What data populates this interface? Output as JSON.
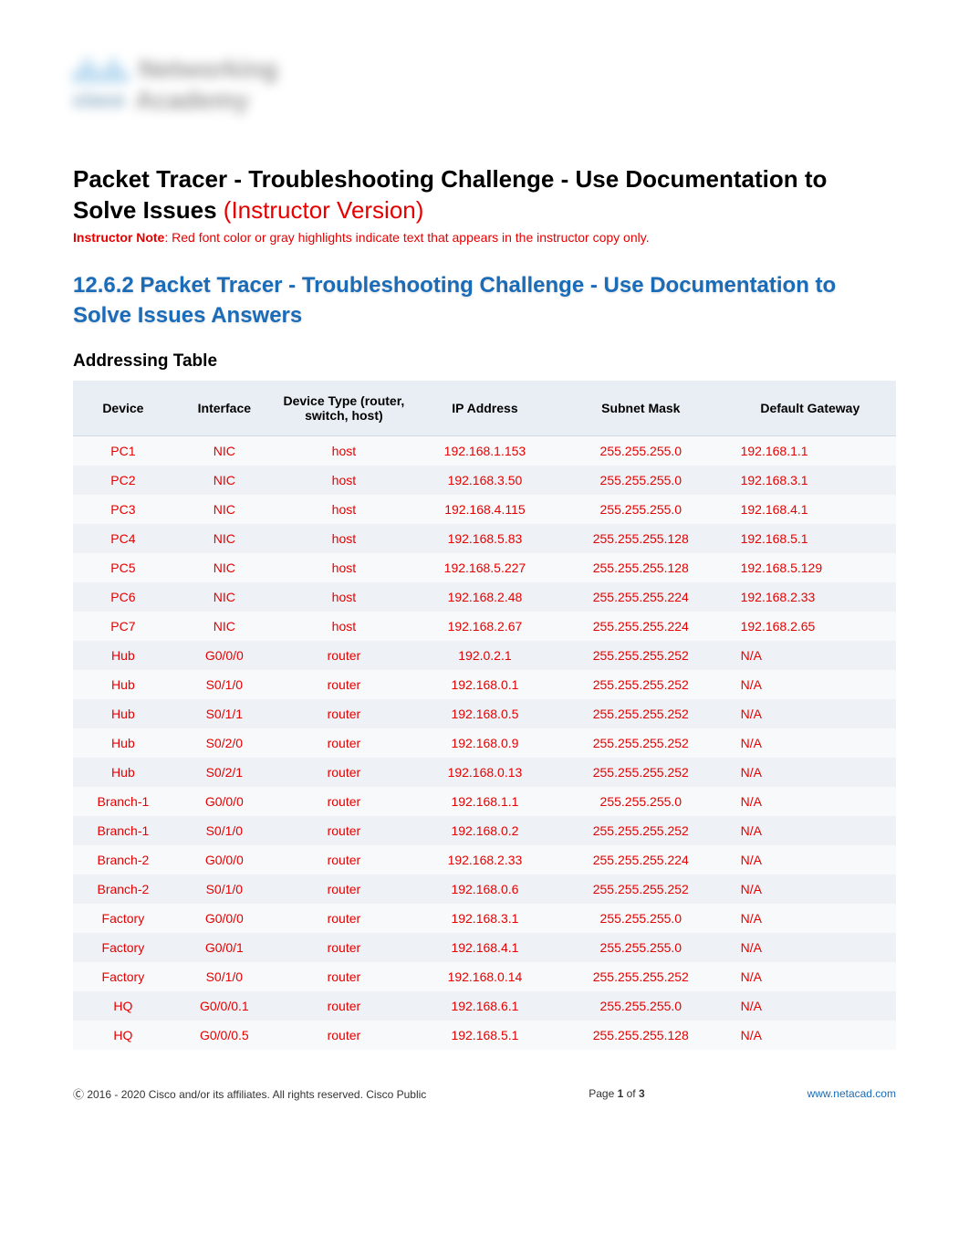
{
  "header": {
    "logo_top": "Networking",
    "logo_bottom_left": "cisco",
    "logo_bottom_right": "Academy"
  },
  "title": {
    "main": "Packet Tracer - Troubleshooting Challenge - Use Documentation to Solve Issues",
    "version": "(Instructor Version)"
  },
  "instructor_note": {
    "label": "Instructor Note",
    "text": ": Red font color or gray highlights indicate text that appears in the instructor copy only."
  },
  "link_heading": "12.6.2 Packet Tracer - Troubleshooting Challenge - Use Documentation to Solve Issues Answers",
  "section_heading": "Addressing Table",
  "table": {
    "headers": {
      "device": "Device",
      "interface": "Interface",
      "device_type": "Device Type (router, switch, host)",
      "ip": "IP Address",
      "mask": "Subnet Mask",
      "gateway": "Default Gateway"
    },
    "rows": [
      {
        "device": "PC1",
        "interface": "NIC",
        "type": "host",
        "ip": "192.168.1.153",
        "mask": "255.255.255.0",
        "gateway": "192.168.1.1"
      },
      {
        "device": "PC2",
        "interface": "NIC",
        "type": "host",
        "ip": "192.168.3.50",
        "mask": "255.255.255.0",
        "gateway": "192.168.3.1"
      },
      {
        "device": "PC3",
        "interface": "NIC",
        "type": "host",
        "ip": "192.168.4.115",
        "mask": "255.255.255.0",
        "gateway": "192.168.4.1"
      },
      {
        "device": "PC4",
        "interface": "NIC",
        "type": "host",
        "ip": "192.168.5.83",
        "mask": "255.255.255.128",
        "gateway": "192.168.5.1"
      },
      {
        "device": "PC5",
        "interface": "NIC",
        "type": "host",
        "ip": "192.168.5.227",
        "mask": "255.255.255.128",
        "gateway": "192.168.5.129"
      },
      {
        "device": "PC6",
        "interface": "NIC",
        "type": "host",
        "ip": "192.168.2.48",
        "mask": "255.255.255.224",
        "gateway": "192.168.2.33"
      },
      {
        "device": "PC7",
        "interface": "NIC",
        "type": "host",
        "ip": "192.168.2.67",
        "mask": "255.255.255.224",
        "gateway": "192.168.2.65"
      },
      {
        "device": "Hub",
        "interface": "G0/0/0",
        "type": "router",
        "ip": "192.0.2.1",
        "mask": "255.255.255.252",
        "gateway": "N/A"
      },
      {
        "device": "Hub",
        "interface": "S0/1/0",
        "type": "router",
        "ip": "192.168.0.1",
        "mask": "255.255.255.252",
        "gateway": "N/A"
      },
      {
        "device": "Hub",
        "interface": "S0/1/1",
        "type": "router",
        "ip": "192.168.0.5",
        "mask": "255.255.255.252",
        "gateway": "N/A"
      },
      {
        "device": "Hub",
        "interface": "S0/2/0",
        "type": "router",
        "ip": "192.168.0.9",
        "mask": "255.255.255.252",
        "gateway": "N/A"
      },
      {
        "device": "Hub",
        "interface": "S0/2/1",
        "type": "router",
        "ip": "192.168.0.13",
        "mask": "255.255.255.252",
        "gateway": "N/A"
      },
      {
        "device": "Branch-1",
        "interface": "G0/0/0",
        "type": "router",
        "ip": "192.168.1.1",
        "mask": "255.255.255.0",
        "gateway": "N/A"
      },
      {
        "device": "Branch-1",
        "interface": "S0/1/0",
        "type": "router",
        "ip": "192.168.0.2",
        "mask": "255.255.255.252",
        "gateway": "N/A"
      },
      {
        "device": "Branch-2",
        "interface": "G0/0/0",
        "type": "router",
        "ip": "192.168.2.33",
        "mask": "255.255.255.224",
        "gateway": "N/A"
      },
      {
        "device": "Branch-2",
        "interface": "S0/1/0",
        "type": "router",
        "ip": "192.168.0.6",
        "mask": "255.255.255.252",
        "gateway": "N/A"
      },
      {
        "device": "Factory",
        "interface": "G0/0/0",
        "type": "router",
        "ip": "192.168.3.1",
        "mask": "255.255.255.0",
        "gateway": "N/A"
      },
      {
        "device": "Factory",
        "interface": "G0/0/1",
        "type": "router",
        "ip": "192.168.4.1",
        "mask": "255.255.255.0",
        "gateway": "N/A"
      },
      {
        "device": "Factory",
        "interface": "S0/1/0",
        "type": "router",
        "ip": "192.168.0.14",
        "mask": "255.255.255.252",
        "gateway": "N/A"
      },
      {
        "device": "HQ",
        "interface": "G0/0/0.1",
        "type": "router",
        "ip": "192.168.6.1",
        "mask": "255.255.255.0",
        "gateway": "N/A"
      },
      {
        "device": "HQ",
        "interface": "G0/0/0.5",
        "type": "router",
        "ip": "192.168.5.1",
        "mask": "255.255.255.128",
        "gateway": "N/A"
      }
    ]
  },
  "footer": {
    "copyright": "Ⓒ 2016 - 2020 Cisco and/or its affiliates. All rights reserved. Cisco Public",
    "page_prefix": "Page ",
    "page_current": "1",
    "page_of": " of ",
    "page_total": "3",
    "link": "www.netacad.com"
  }
}
